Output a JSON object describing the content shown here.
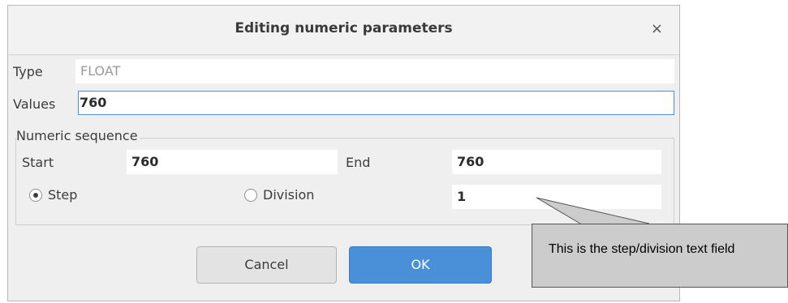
{
  "dialog": {
    "title": "Editing numeric parameters",
    "close_glyph": "×"
  },
  "form": {
    "type_label": "Type",
    "type_value": "FLOAT",
    "values_label": "Values",
    "values_value": "760"
  },
  "sequence": {
    "group_title": "Numeric sequence",
    "start_label": "Start",
    "start_value": "760",
    "end_label": "End",
    "end_value": "760",
    "step_label": "Step",
    "division_label": "Division",
    "selected_mode": "Step",
    "step_value": "1"
  },
  "buttons": {
    "cancel_label": "Cancel",
    "ok_label": "OK"
  },
  "annotation": {
    "text": "This is the step/division text field"
  },
  "colors": {
    "accent": "#4a90d9",
    "callout_bg": "#cccccc"
  }
}
